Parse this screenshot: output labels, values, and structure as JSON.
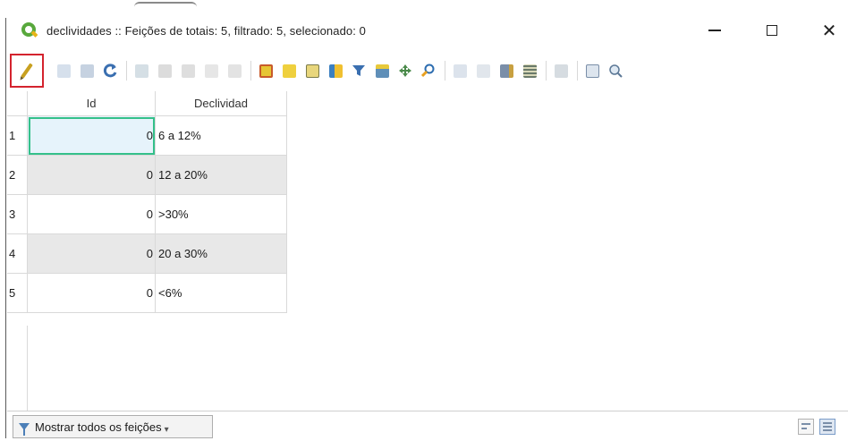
{
  "window": {
    "title": "declividades :: Feições de totais: 5, filtrado: 5, selecionado: 0",
    "minimize_symbol": "—",
    "close_symbol": "✕"
  },
  "toolbar": {
    "buttons": [
      {
        "name": "toggle-editing",
        "icon": "pencil-icon",
        "enabled": true,
        "highlighted": true
      },
      {
        "name": "toggle-multi-edit",
        "icon": "multi-edit-icon",
        "enabled": false
      },
      {
        "name": "save-edits",
        "icon": "save-icon",
        "enabled": false
      },
      {
        "name": "reload-table",
        "icon": "refresh-icon",
        "enabled": true
      },
      {
        "name": "add-feature",
        "icon": "add-feature-icon",
        "enabled": false
      },
      {
        "name": "delete-selected",
        "icon": "delete-icon",
        "enabled": false
      },
      {
        "name": "cut-features",
        "icon": "cut-icon",
        "enabled": false
      },
      {
        "name": "copy-features",
        "icon": "copy-icon",
        "enabled": false
      },
      {
        "name": "paste-features",
        "icon": "paste-icon",
        "enabled": false
      },
      {
        "name": "select-by-expression",
        "icon": "expression-select-icon",
        "enabled": true
      },
      {
        "name": "select-all",
        "icon": "select-all-icon",
        "enabled": true
      },
      {
        "name": "invert-selection",
        "icon": "invert-selection-icon",
        "enabled": true
      },
      {
        "name": "deselect-all",
        "icon": "deselect-icon",
        "enabled": true
      },
      {
        "name": "filter-select",
        "icon": "filter-icon",
        "enabled": true
      },
      {
        "name": "move-selection-top",
        "icon": "move-top-icon",
        "enabled": true
      },
      {
        "name": "pan-to-selection",
        "icon": "pan-icon",
        "enabled": true
      },
      {
        "name": "zoom-to-selection",
        "icon": "zoom-selection-icon",
        "enabled": true
      },
      {
        "name": "new-field",
        "icon": "new-field-icon",
        "enabled": false
      },
      {
        "name": "delete-field",
        "icon": "delete-field-icon",
        "enabled": false
      },
      {
        "name": "field-calculator",
        "icon": "field-calculator-icon",
        "enabled": true
      },
      {
        "name": "conditional-formatting",
        "icon": "conditional-format-icon",
        "enabled": true
      },
      {
        "name": "actions",
        "icon": "actions-icon",
        "enabled": false
      },
      {
        "name": "dock-table",
        "icon": "dock-icon",
        "enabled": true
      },
      {
        "name": "zoom-map",
        "icon": "zoom-map-icon",
        "enabled": true
      }
    ]
  },
  "table": {
    "columns": [
      "Id",
      "Declividad"
    ],
    "rows": [
      {
        "num": "1",
        "id": "0",
        "decl": "6 a 12%"
      },
      {
        "num": "2",
        "id": "0",
        "decl": "12 a 20%"
      },
      {
        "num": "3",
        "id": "0",
        "decl": ">30%"
      },
      {
        "num": "4",
        "id": "0",
        "decl": "20 a 30%"
      },
      {
        "num": "5",
        "id": "0",
        "decl": "<6%"
      }
    ]
  },
  "bottombar": {
    "filter_label": "Mostrar todos os feições"
  },
  "colors": {
    "highlight_border": "#d4232e",
    "active_cell_border": "#34c08a",
    "alt_row": "#e8e8e8"
  }
}
